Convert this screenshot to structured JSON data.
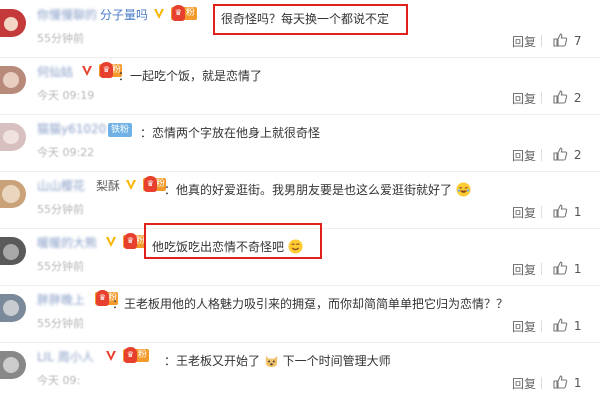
{
  "comments": [
    {
      "name": "你慢慢聊的分子量吗",
      "name_clear": "分子量吗",
      "time": "55分钟前",
      "text": "很奇怪吗？每天换一个都说不定",
      "reply": "回复",
      "likes": "7",
      "badges": [
        "v",
        "fan"
      ],
      "avatar_color": "#c43a3a"
    },
    {
      "name": "何仙姑",
      "time": "今天 09:19",
      "text": "：一起吃个饭，就是恋情了",
      "reply": "回复",
      "likes": "2",
      "badges": [
        "v",
        "fan"
      ],
      "avatar_color": "#b88a7a"
    },
    {
      "name": "猫猫y61020",
      "time": "今天 09:22",
      "text": "：恋情两个字放在他身上就很奇怪",
      "reply": "回复",
      "likes": "2",
      "badges": [
        "iron"
      ],
      "iron_label": "铁粉",
      "avatar_color": "#d9c0c0"
    },
    {
      "name": "山山樱花",
      "name_clear": "梨酥",
      "time": "55分钟前",
      "text": "：他真的好爱逛街。我男朋友要是也这么爱逛街就好了",
      "reply": "回复",
      "likes": "1",
      "badges": [
        "v",
        "fan"
      ],
      "emoji": "laugh-emoji",
      "avatar_color": "#c9a27a"
    },
    {
      "name": "暖暖的大熊",
      "time": "55分钟前",
      "text": "他吃饭吃出恋情不奇怪吧",
      "reply": "回复",
      "likes": "1",
      "badges": [
        "v",
        "fan"
      ],
      "emoji": "smile-emoji",
      "avatar_color": "#5a5a5a"
    },
    {
      "name": "胖胖晚上",
      "time": "55分钟前",
      "text": "：王老板用他的人格魅力吸引来的拥趸，而你却简简单单把它归为恋情？？",
      "reply": "回复",
      "likes": "1",
      "badges": [
        "fan"
      ],
      "avatar_color": "#7a8a9a"
    },
    {
      "name": "LIL 周小人",
      "time": "今天 09:",
      "text": "：王老板又开始了",
      "text_after": "下一个时间管理大师",
      "reply": "回复",
      "likes": "1",
      "badges": [
        "v",
        "fan"
      ],
      "emoji": "dog-emoji",
      "avatar_color": "#888888"
    }
  ],
  "fan_label": "粉",
  "colors": {
    "highlight": "#e2211c",
    "name": "#4a7bc8",
    "badge_orange": "#f49a2b",
    "v_yellow": "#f7b500"
  }
}
